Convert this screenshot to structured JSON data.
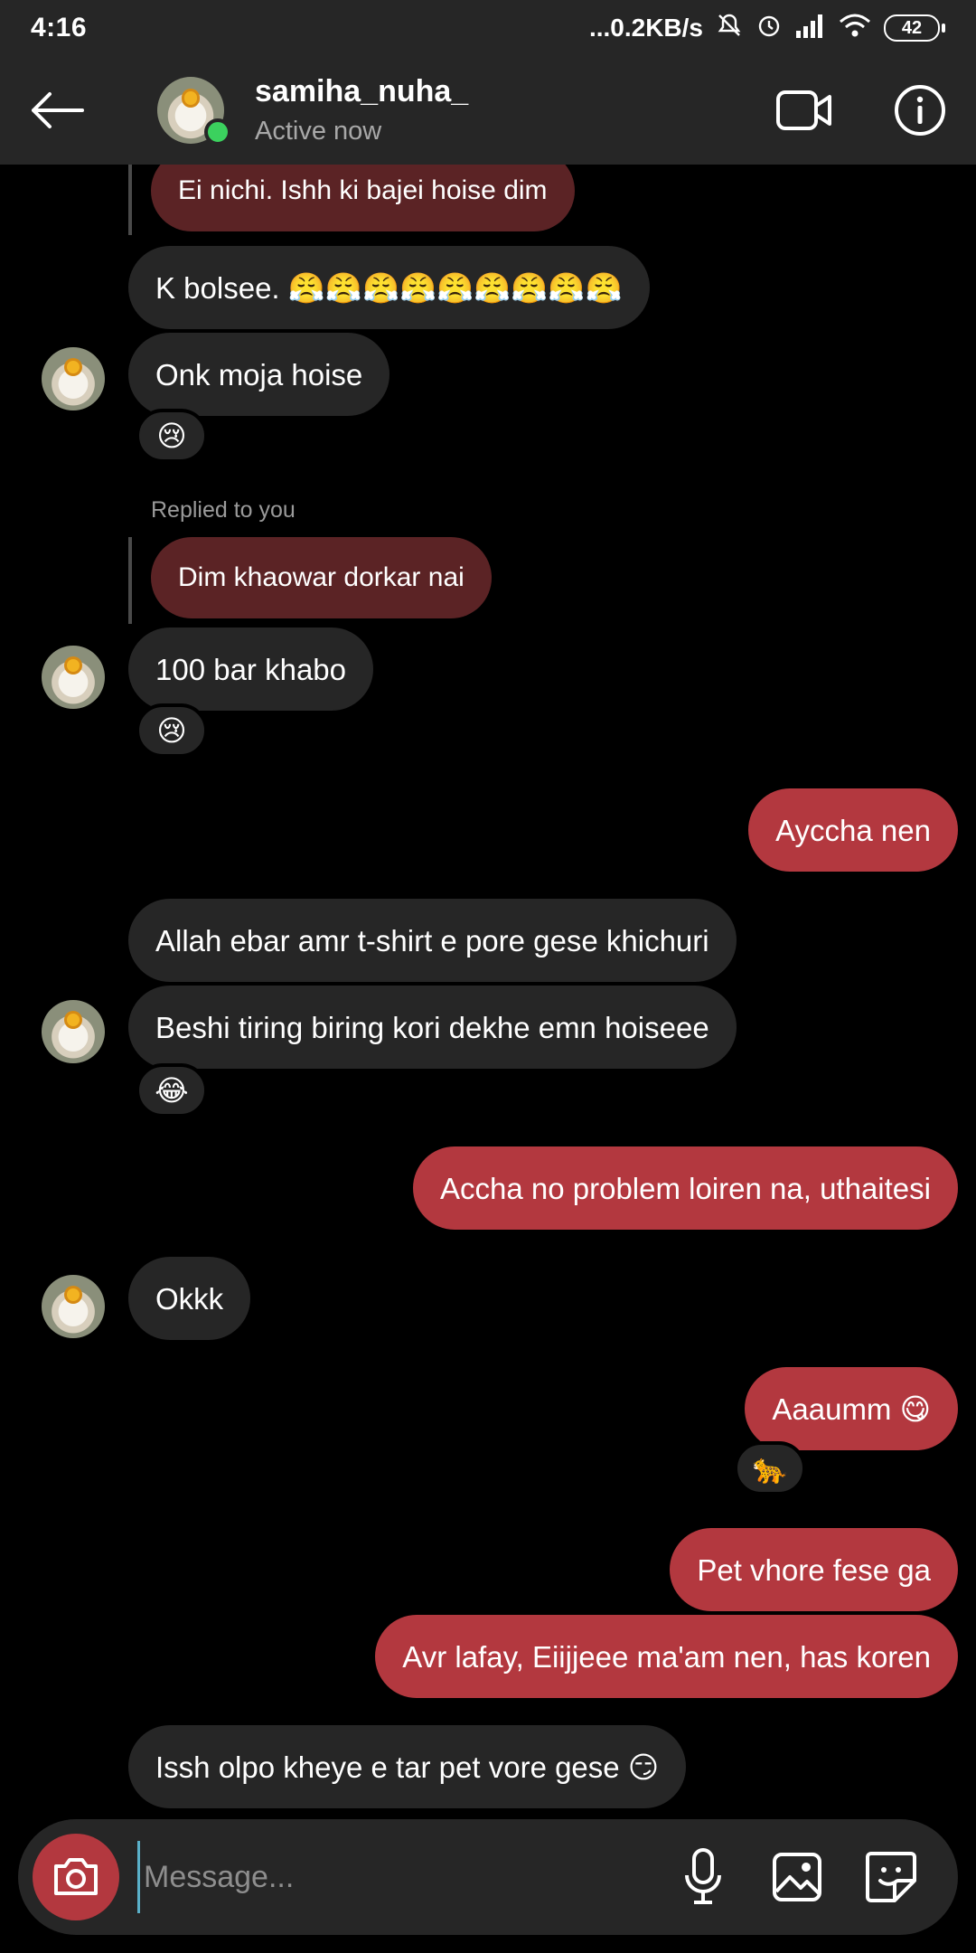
{
  "status_bar": {
    "time": "4:16",
    "network_speed": "...0.2KB/s",
    "battery": "42",
    "icons": [
      "mute-icon",
      "alarm-icon",
      "signal-icon",
      "wifi-icon",
      "battery-icon"
    ]
  },
  "header": {
    "username": "samiha_nuha_",
    "presence": "Active now",
    "icons": [
      "back-arrow-icon",
      "video-call-icon",
      "info-icon"
    ]
  },
  "messages": [
    {
      "id": "m1",
      "type": "quote",
      "text": "Ei nichi. Ishh ki bajei hoise dim"
    },
    {
      "id": "m2",
      "type": "incoming",
      "text": "K bolsee. 😤😤😤😤😤😤😤😤😤"
    },
    {
      "id": "m3",
      "type": "incoming",
      "text": "Onk moja hoise",
      "reaction": "😢"
    },
    {
      "id": "m4",
      "type": "reply_label",
      "text": "Replied to you"
    },
    {
      "id": "m5",
      "type": "quote",
      "text": "Dim khaowar dorkar nai"
    },
    {
      "id": "m6",
      "type": "incoming",
      "text": "100 bar khabo",
      "reaction": "😢"
    },
    {
      "id": "m7",
      "type": "outgoing",
      "text": "Ayccha nen"
    },
    {
      "id": "m8",
      "type": "incoming",
      "text": "Allah ebar amr t-shirt e pore gese khichuri"
    },
    {
      "id": "m9",
      "type": "incoming",
      "text": "Beshi tiring biring kori dekhe emn hoiseee",
      "reaction": "😂"
    },
    {
      "id": "m10",
      "type": "outgoing",
      "text": "Accha no problem loiren na, uthaitesi"
    },
    {
      "id": "m11",
      "type": "incoming",
      "text": "Okkk"
    },
    {
      "id": "m12",
      "type": "outgoing",
      "text": "Aaaumm 😋",
      "reaction": "🐆"
    },
    {
      "id": "m13",
      "type": "outgoing",
      "text": "Pet vhore fese ga"
    },
    {
      "id": "m14",
      "type": "outgoing",
      "text": "Avr lafay, Eiijjeee ma'am nen, has koren"
    },
    {
      "id": "m15",
      "type": "incoming",
      "text": "Issh olpo kheye e tar pet vore gese 😏"
    }
  ],
  "composer": {
    "placeholder": "Message...",
    "icons": [
      "camera-icon",
      "microphone-icon",
      "gallery-icon",
      "sticker-icon"
    ]
  },
  "colors": {
    "background": "#000000",
    "bar": "#262626",
    "incoming_bubble": "#262626",
    "outgoing_bubble": "#b3383f",
    "quoted_bubble": "#5b2325",
    "online": "#3bd15e"
  }
}
